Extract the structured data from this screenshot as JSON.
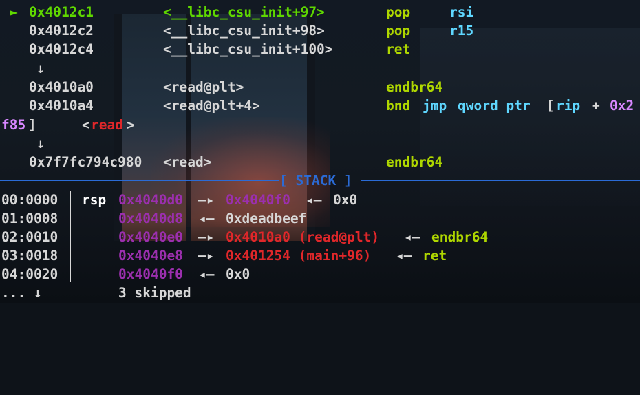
{
  "disasm": [
    {
      "arrow": "►",
      "addr": "0x4012c1",
      "sym": "<__libc_csu_init+97>",
      "mnem": "pop",
      "op": "rsi"
    },
    {
      "arrow": "",
      "addr": "0x4012c2",
      "sym": "<__libc_csu_init+98>",
      "mnem": "pop",
      "op": "r15"
    },
    {
      "arrow": "",
      "addr": "0x4012c4",
      "sym": "<__libc_csu_init+100>",
      "mnem": "ret",
      "op": ""
    },
    {
      "down": "↓"
    },
    {
      "addr": "0x4010a0",
      "sym": "<read@plt>",
      "mnem": "endbr64"
    },
    {
      "addr": "0x4010a4",
      "sym": "<read@plt+4>",
      "mnem_bnd": "bnd",
      "mnem_jmp": "jmp",
      "op_qword": "qword ptr",
      "bracket": "[",
      "reg": "rip",
      "plus": "+",
      "imm_a": "0x2"
    },
    {
      "imm_b": "f85",
      "bracket_close": "]",
      "lt": "<",
      "sym_read": "read",
      "gt": ">"
    },
    {
      "down": "↓"
    },
    {
      "addr": "0x7f7fc794c980",
      "sym": "<read>",
      "mnem": "endbr64"
    }
  ],
  "stack_header": "[ STACK ]",
  "stack": [
    {
      "offset": "00:0000",
      "reg": "rsp",
      "addr": "0x4040d0",
      "arrow1": "—▸",
      "ptr": "0x4040f0",
      "arrow2": "◂—",
      "val": "0x0"
    },
    {
      "offset": "01:0008",
      "addr": "0x4040d8",
      "arrow1": "◂—",
      "val": "0xdeadbeef"
    },
    {
      "offset": "02:0010",
      "addr": "0x4040e0",
      "arrow1": "—▸",
      "ptr": "0x4010a0 (read@plt)",
      "arrow2": "◂—",
      "val": "endbr64"
    },
    {
      "offset": "03:0018",
      "addr": "0x4040e8",
      "arrow1": "—▸",
      "ptr": "0x401254 (main+96)",
      "arrow2": "◂—",
      "val": "ret"
    },
    {
      "offset": "04:0020",
      "addr": "0x4040f0",
      "arrow1": "◂—",
      "val": "0x0"
    }
  ],
  "skipped": {
    "dots": "... ↓",
    "text": "3 skipped"
  },
  "colors": {
    "current": "#5fd700",
    "mnemonic": "#afd700",
    "register": "#5fd7ff",
    "immediate": "#d787ff",
    "stack_addr": "#9b2fae",
    "code_ptr": "#e0272a",
    "header": "#2b6bd6"
  }
}
